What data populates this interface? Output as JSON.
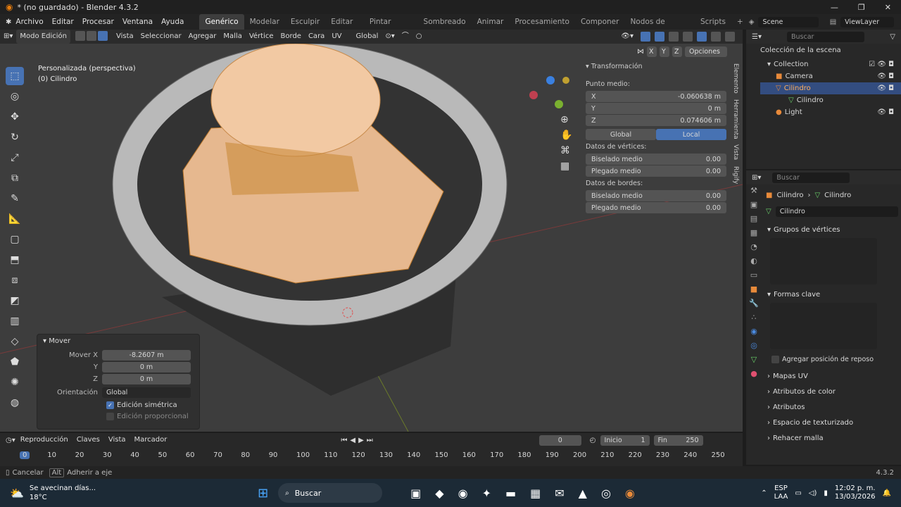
{
  "title": "* (no guardado) - Blender 4.3.2",
  "menu": [
    "Archivo",
    "Editar",
    "Procesar",
    "Ventana",
    "Ayuda"
  ],
  "workspaces": [
    "Genérico",
    "Modelar",
    "Esculpir",
    "Editar UV",
    "Pintar texturas",
    "Sombreado",
    "Animar",
    "Procesamiento",
    "Componer",
    "Nodos de geometría",
    "Scripts"
  ],
  "scene": "Scene",
  "view_layer": "ViewLayer",
  "header": {
    "mode": "Modo Edición",
    "items": [
      "Vista",
      "Seleccionar",
      "Agregar",
      "Malla",
      "Vértice",
      "Borde",
      "Cara",
      "UV"
    ],
    "orientation": "Global",
    "options": "Opciones",
    "axes": [
      "X",
      "Y",
      "Z"
    ]
  },
  "viewport": {
    "view_name": "Personalizada (perspectiva)",
    "object_name": "(0) Cilindro"
  },
  "npanel": {
    "section": "Transformación",
    "median": "Punto medio:",
    "x_label": "X",
    "x": "-0.060638 m",
    "y_label": "Y",
    "y": "0 m",
    "z_label": "Z",
    "z": "0.074606 m",
    "global": "Global",
    "local": "Local",
    "vertex_data": "Datos de vértices:",
    "bevel_weight": "Biselado medio",
    "bevel_weight_val": "0.00",
    "crease": "Plegado medio",
    "crease_val": "0.00",
    "edge_data": "Datos de bordes:",
    "edge_bevel": "Biselado medio",
    "edge_bevel_val": "0.00",
    "edge_crease": "Plegado medio",
    "edge_crease_val": "0.00"
  },
  "side_tabs": [
    "Elemento",
    "Herramienta",
    "Vista",
    "Rigify"
  ],
  "mover": {
    "title": "Mover",
    "x_label": "Mover X",
    "x": "-8.2607 m",
    "y_label": "Y",
    "y": "0 m",
    "z_label": "Z",
    "z": "0 m",
    "orient_label": "Orientación",
    "orient": "Global",
    "symmetric": "Edición simétrica",
    "proportional": "Edición proporcional"
  },
  "outliner": {
    "search": "Buscar",
    "root": "Colección de la escena",
    "items": [
      {
        "name": "Collection"
      },
      {
        "name": "Camera"
      },
      {
        "name": "Cilindro"
      },
      {
        "name": "Cilindro"
      },
      {
        "name": "Light"
      }
    ]
  },
  "properties": {
    "search": "Buscar",
    "breadcrumb1": "Cilindro",
    "breadcrumb2": "Cilindro",
    "mesh_name": "Cilindro",
    "vertex_groups": "Grupos de vértices",
    "shape_keys": "Formas clave",
    "rest_pos": "Agregar posición de reposo",
    "sections": [
      "Mapas UV",
      "Atributos de color",
      "Atributos",
      "Espacio de texturizado",
      "Rehacer malla"
    ]
  },
  "timeline": {
    "menus": [
      "Reproducción",
      "Claves",
      "Vista",
      "Marcador"
    ],
    "current_frame": "0",
    "start_label": "Inicio",
    "start": "1",
    "end_label": "Fin",
    "end": "250",
    "ticks": [
      "0",
      "10",
      "20",
      "30",
      "40",
      "50",
      "60",
      "70",
      "80",
      "90",
      "100",
      "110",
      "120",
      "130",
      "140",
      "150",
      "160",
      "170",
      "180",
      "190",
      "200",
      "210",
      "220",
      "230",
      "240",
      "250"
    ]
  },
  "status": {
    "cancel": "Cancelar",
    "alt": "Alt",
    "snap": "Adherir a eje",
    "version": "4.3.2"
  },
  "taskbar": {
    "weather": "Se avecinan días...",
    "temp": "18°C",
    "search": "Buscar",
    "lang1": "ESP",
    "lang2": "LAA",
    "time": "12:02 p. m.",
    "date": "13/03/2026"
  }
}
